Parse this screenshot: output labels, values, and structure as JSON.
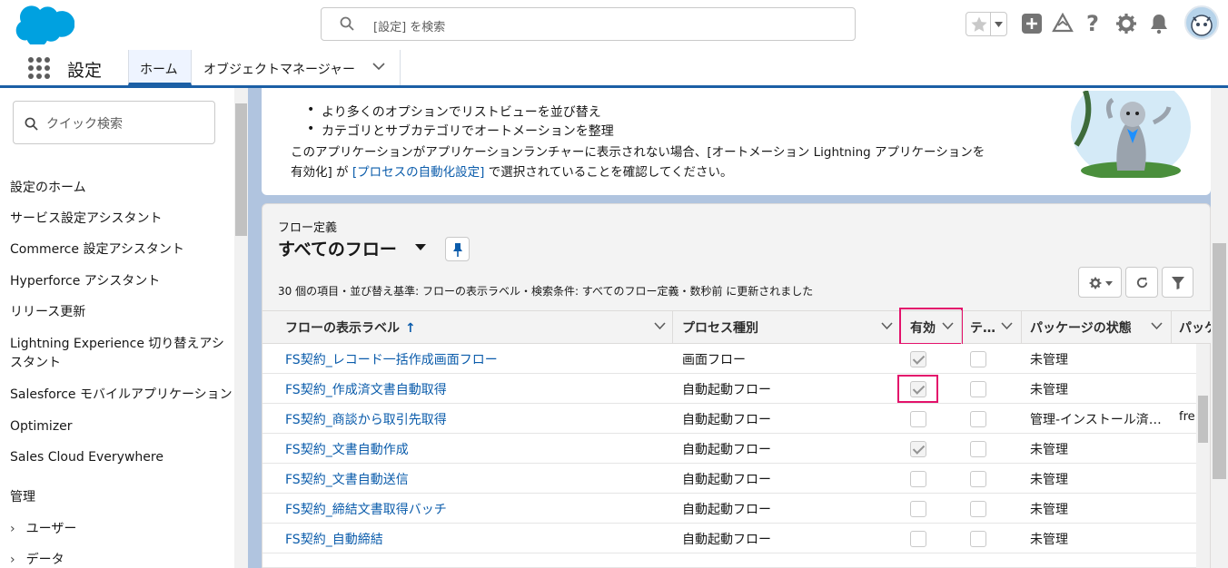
{
  "header": {
    "search_placeholder": "[設定] を検索",
    "icons": [
      "favorites-star-icon",
      "add-icon",
      "trailhead-icon",
      "help-icon",
      "gear-icon",
      "bell-icon",
      "avatar"
    ]
  },
  "nav": {
    "app_name": "設定",
    "tabs": [
      {
        "label": "ホーム",
        "active": true
      },
      {
        "label": "オブジェクトマネージャー",
        "active": false
      }
    ]
  },
  "sidebar": {
    "quick_find_placeholder": "クイック検索",
    "items": [
      "設定のホーム",
      "サービス設定アシスタント",
      "Commerce 設定アシスタント",
      "Hyperforce アシスタント",
      "リリース更新",
      "Lightning Experience 切り替えアシスタント",
      "Salesforce モバイルアプリケーション",
      "Optimizer",
      "Sales Cloud Everywhere"
    ],
    "section_title": "管理",
    "section_items": [
      "ユーザー",
      "データ"
    ]
  },
  "info_card": {
    "bullets": [
      "より多くのオプションでリストビューを並び替え",
      "カテゴリとサブカテゴリでオートメーションを整理"
    ],
    "line1": "このアプリケーションがアプリケーションランチャーに表示されない場合、[オートメーション Lightning アプリケーションを",
    "line2_pre": "有効化] が ",
    "line2_link": "[プロセスの自動化設定]",
    "line2_post": " で選択されていることを確認してください。"
  },
  "list": {
    "object_name": "フロー定義",
    "view_name": "すべてのフロー",
    "summary": "30 個の項目・並び替え基準: フローの表示ラベル・検索条件: すべてのフロー定義・数秒前 に更新されました",
    "columns": [
      "フローの表示ラベル",
      "プロセス種別",
      "有効",
      "テ…",
      "パッケージの状態",
      "パッケ…"
    ],
    "rows": [
      {
        "label": "FS契約_レコード一括作成画面フロー",
        "type": "画面フロー",
        "active": true,
        "template": false,
        "package": "未管理",
        "extra": ""
      },
      {
        "label": "FS契約_作成済文書自動取得",
        "type": "自動起動フロー",
        "active": true,
        "template": false,
        "package": "未管理",
        "extra": ""
      },
      {
        "label": "FS契約_商談から取引先取得",
        "type": "自動起動フロー",
        "active": false,
        "template": false,
        "package": "管理-インストール済…",
        "extra": "fre"
      },
      {
        "label": "FS契約_文書自動作成",
        "type": "自動起動フロー",
        "active": true,
        "template": false,
        "package": "未管理",
        "extra": ""
      },
      {
        "label": "FS契約_文書自動送信",
        "type": "自動起動フロー",
        "active": false,
        "template": false,
        "package": "未管理",
        "extra": ""
      },
      {
        "label": "FS契約_締結文書取得バッチ",
        "type": "自動起動フロー",
        "active": false,
        "template": false,
        "package": "未管理",
        "extra": ""
      },
      {
        "label": "FS契約_自動締結",
        "type": "自動起動フロー",
        "active": false,
        "template": false,
        "package": "未管理",
        "extra": ""
      }
    ]
  },
  "colors": {
    "brand": "#0b5cab",
    "highlight": "#e3126b",
    "nav_accent": "#1b5fa5"
  }
}
